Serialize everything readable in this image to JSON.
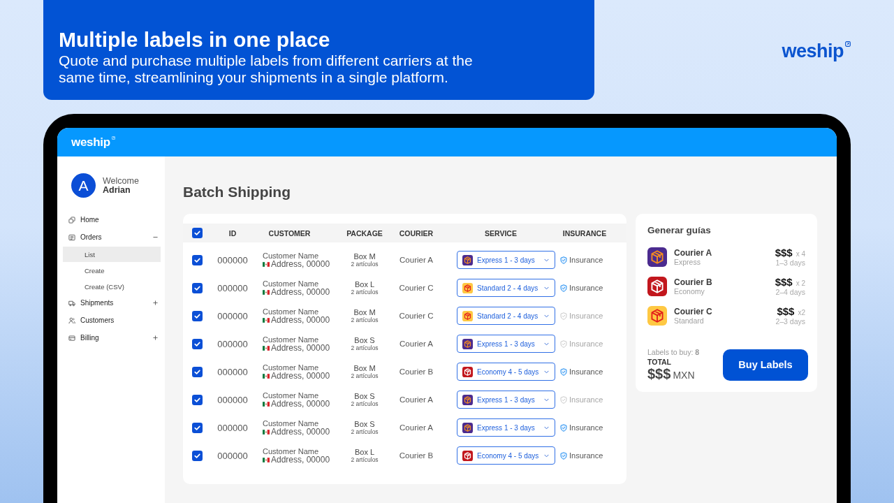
{
  "banner": {
    "title": "Multiple labels in one place",
    "description": "Quote and purchase multiple labels from different carriers at the same time, streamlining your shipments in a single platform."
  },
  "brand": {
    "logo": "weship"
  },
  "app": {
    "logo": "weship",
    "user": {
      "initial": "A",
      "greeting": "Welcome",
      "name": "Adrian"
    },
    "sidebar": {
      "items": [
        {
          "label": "Home",
          "kind": "link",
          "selected": false,
          "expanded": false
        },
        {
          "label": "Orders",
          "kind": "group",
          "selected": false,
          "expanded": true,
          "children": [
            {
              "label": "List",
              "selected": true
            },
            {
              "label": "Create",
              "selected": false
            },
            {
              "label": "Create (CSV)",
              "selected": false
            }
          ]
        },
        {
          "label": "Shipments",
          "kind": "group",
          "selected": false,
          "expanded": false
        },
        {
          "label": "Customers",
          "kind": "link",
          "selected": false,
          "expanded": false
        },
        {
          "label": "Billing",
          "kind": "group",
          "selected": false,
          "expanded": false
        }
      ]
    },
    "page_title": "Batch Shipping",
    "table": {
      "all_checked": true,
      "columns": [
        "ID",
        "CUSTOMER",
        "PACKAGE",
        "COURIER",
        "SERVICE",
        "INSURANCE"
      ],
      "rows": [
        {
          "checked": true,
          "id": "000000",
          "customer": "Customer Name",
          "address": "Address, 00000",
          "package": "Box M",
          "items": "2 artículos",
          "courier": "Courier A",
          "service": {
            "kind": "express",
            "label": "Express 1 - 3 days"
          },
          "insurance": {
            "label": "Insurance",
            "included": true
          }
        },
        {
          "checked": true,
          "id": "000000",
          "customer": "Customer Name",
          "address": "Address, 00000",
          "package": "Box L",
          "items": "2 artículos",
          "courier": "Courier C",
          "service": {
            "kind": "standard",
            "label": "Standard 2 - 4 days"
          },
          "insurance": {
            "label": "Insurance",
            "included": true
          }
        },
        {
          "checked": true,
          "id": "000000",
          "customer": "Customer Name",
          "address": "Address, 00000",
          "package": "Box M",
          "items": "2 artículos",
          "courier": "Courier C",
          "service": {
            "kind": "standard",
            "label": "Standard 2 - 4 days"
          },
          "insurance": {
            "label": "Insurance",
            "included": false
          }
        },
        {
          "checked": true,
          "id": "000000",
          "customer": "Customer Name",
          "address": "Address, 00000",
          "package": "Box S",
          "items": "2 artículos",
          "courier": "Courier A",
          "service": {
            "kind": "express",
            "label": "Express 1 - 3 days"
          },
          "insurance": {
            "label": "Insurance",
            "included": false
          }
        },
        {
          "checked": true,
          "id": "000000",
          "customer": "Customer Name",
          "address": "Address, 00000",
          "package": "Box M",
          "items": "2 artículos",
          "courier": "Courier B",
          "service": {
            "kind": "economy",
            "label": "Economy 4 - 5 days"
          },
          "insurance": {
            "label": "Insurance",
            "included": true
          }
        },
        {
          "checked": true,
          "id": "000000",
          "customer": "Customer Name",
          "address": "Address, 00000",
          "package": "Box S",
          "items": "2 artículos",
          "courier": "Courier A",
          "service": {
            "kind": "express",
            "label": "Express 1 - 3 days"
          },
          "insurance": {
            "label": "Insurance",
            "included": false
          }
        },
        {
          "checked": true,
          "id": "000000",
          "customer": "Customer Name",
          "address": "Address, 00000",
          "package": "Box S",
          "items": "2 artículos",
          "courier": "Courier A",
          "service": {
            "kind": "express",
            "label": "Express 1 - 3 days"
          },
          "insurance": {
            "label": "Insurance",
            "included": true
          }
        },
        {
          "checked": true,
          "id": "000000",
          "customer": "Customer Name",
          "address": "Address, 00000",
          "package": "Box L",
          "items": "2 artículos",
          "courier": "Courier B",
          "service": {
            "kind": "economy",
            "label": "Economy 4 - 5 days"
          },
          "insurance": {
            "label": "Insurance",
            "included": true
          }
        }
      ]
    },
    "summary": {
      "title": "Generar guías",
      "couriers": [
        {
          "kind": "express",
          "name": "Courier A",
          "service": "Express",
          "price": "$$$",
          "quantity": "x 4",
          "days": "1–3 days"
        },
        {
          "kind": "economy",
          "name": "Courier B",
          "service": "Economy",
          "price": "$$$",
          "quantity": "x 2",
          "days": "2–4 days"
        },
        {
          "kind": "standard",
          "name": "Courier C",
          "service": "Standard",
          "price": "$$$",
          "quantity": "x2",
          "days": "2–3 days"
        }
      ],
      "labels_to_buy": "Labels to buy: **8**",
      "total_label": "TOTAL",
      "total": "$$$",
      "currency": "MXN",
      "button": "Buy Labels"
    }
  }
}
